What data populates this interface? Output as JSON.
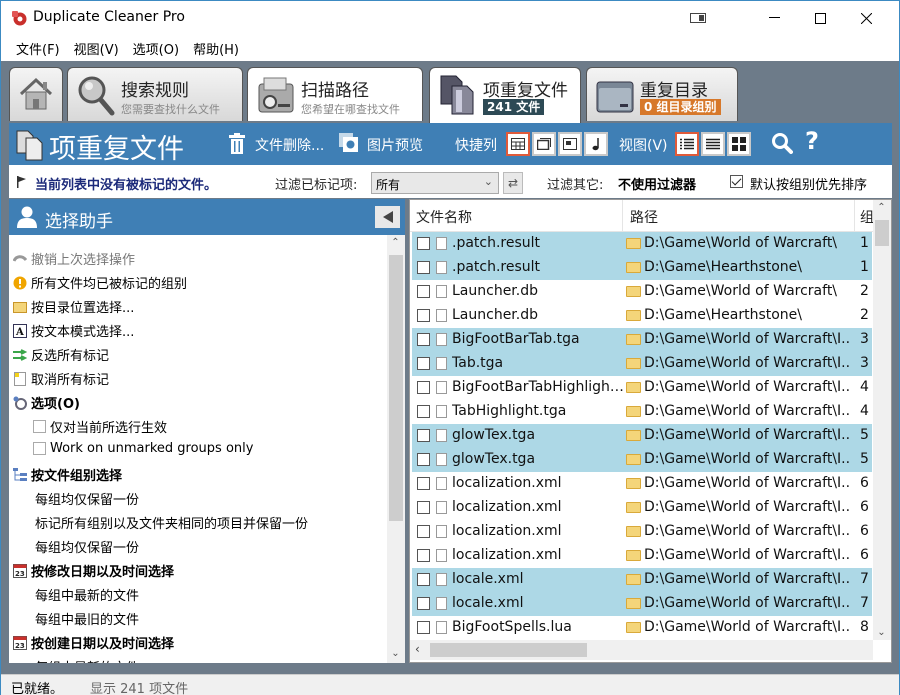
{
  "window": {
    "title": "Duplicate Cleaner Pro",
    "controls": {
      "extra": "▭",
      "minimize": "—",
      "maximize": "☐",
      "close": "✕"
    }
  },
  "menu": [
    "文件(F)",
    "视图(V)",
    "选项(O)",
    "帮助(H)"
  ],
  "tabs": [
    {
      "id": "home",
      "title": "",
      "sub": ""
    },
    {
      "id": "search-rules",
      "title": "搜索规则",
      "sub": "您需要查找什么文件"
    },
    {
      "id": "scan-path",
      "title": "扫描路径",
      "sub": "您希望在哪查找文件"
    },
    {
      "id": "duplicate-files",
      "title": "项重复文件",
      "badge": "241 文件",
      "badge_color": "#2d4a55"
    },
    {
      "id": "duplicate-folders",
      "title": "重复目录",
      "badge": "0 组目录组别",
      "badge_color": "#d7782a"
    }
  ],
  "toolbar": {
    "title": "项重复文件",
    "delete_label": "文件删除...",
    "preview_label": "图片预览",
    "quick_columns_label": "快捷列",
    "view_label": "视图(V)",
    "search_icon": "search-icon",
    "help_label": "?"
  },
  "filterbar": {
    "status_message": "当前列表中没有被标记的文件。",
    "filter_marked_label": "过滤已标记项:",
    "filter_marked_value": "所有",
    "filter_other_label": "过滤其它:",
    "filter_other_value": "不使用过滤器",
    "sort_by_group_label": "默认按组别优先排序",
    "sort_by_group_checked": true
  },
  "selection_assistant": {
    "title": "选择助手",
    "items": [
      {
        "label": "撤销上次选择操作",
        "icon": "undo-icon",
        "style": "gray"
      },
      {
        "label": "所有文件均已被标记的组别",
        "icon": "warning-icon",
        "style": "normal"
      },
      {
        "label": "按目录位置选择...",
        "icon": "folder-icon",
        "style": "normal"
      },
      {
        "label": "按文本模式选择...",
        "icon": "text-pattern-icon",
        "style": "normal"
      },
      {
        "label": "反选所有标记",
        "icon": "invert-icon",
        "style": "normal"
      },
      {
        "label": "取消所有标记",
        "icon": "clear-marks-icon",
        "style": "normal"
      },
      {
        "label": "选项(O)",
        "icon": "options-icon",
        "style": "bold"
      },
      {
        "label": "仅对当前所选行生效",
        "icon": "checkbox",
        "style": "option"
      },
      {
        "label": "Work on unmarked groups only",
        "icon": "checkbox",
        "style": "option"
      },
      {
        "label": "按文件组别选择",
        "icon": "group-icon",
        "style": "bold"
      },
      {
        "label": "每组均仅保留一份",
        "icon": "",
        "style": "sub"
      },
      {
        "label": "标记所有组别以及文件夹相同的项目并保留一份",
        "icon": "",
        "style": "sub"
      },
      {
        "label": "每组均仅保留一份",
        "icon": "",
        "style": "sub"
      },
      {
        "label": "按修改日期以及时间选择",
        "icon": "calendar-icon",
        "style": "bold"
      },
      {
        "label": "每组中最新的文件",
        "icon": "",
        "style": "sub"
      },
      {
        "label": "每组中最旧的文件",
        "icon": "",
        "style": "sub"
      },
      {
        "label": "按创建日期以及时间选择",
        "icon": "calendar-icon",
        "style": "bold"
      },
      {
        "label": "每组中最新的文件",
        "icon": "",
        "style": "sub"
      }
    ]
  },
  "file_list": {
    "columns": [
      "文件名称",
      "路径",
      "组"
    ],
    "rows": [
      {
        "name": ".patch.result",
        "path": "D:\\Game\\World of Warcraft\\",
        "group": "1",
        "highlight": true
      },
      {
        "name": ".patch.result",
        "path": "D:\\Game\\Hearthstone\\",
        "group": "1",
        "highlight": true
      },
      {
        "name": "Launcher.db",
        "path": "D:\\Game\\World of Warcraft\\",
        "group": "2",
        "highlight": false
      },
      {
        "name": "Launcher.db",
        "path": "D:\\Game\\Hearthstone\\",
        "group": "2",
        "highlight": false
      },
      {
        "name": "BigFootBarTab.tga",
        "path": "D:\\Game\\World of Warcraft\\I...",
        "group": "3",
        "highlight": true
      },
      {
        "name": "Tab.tga",
        "path": "D:\\Game\\World of Warcraft\\I...",
        "group": "3",
        "highlight": true
      },
      {
        "name": "BigFootBarTabHighlight...",
        "path": "D:\\Game\\World of Warcraft\\I...",
        "group": "4",
        "highlight": false
      },
      {
        "name": "TabHighlight.tga",
        "path": "D:\\Game\\World of Warcraft\\I...",
        "group": "4",
        "highlight": false
      },
      {
        "name": "glowTex.tga",
        "path": "D:\\Game\\World of Warcraft\\I...",
        "group": "5",
        "highlight": true
      },
      {
        "name": "glowTex.tga",
        "path": "D:\\Game\\World of Warcraft\\I...",
        "group": "5",
        "highlight": true
      },
      {
        "name": "localization.xml",
        "path": "D:\\Game\\World of Warcraft\\I...",
        "group": "6",
        "highlight": false
      },
      {
        "name": "localization.xml",
        "path": "D:\\Game\\World of Warcraft\\I...",
        "group": "6",
        "highlight": false
      },
      {
        "name": "localization.xml",
        "path": "D:\\Game\\World of Warcraft\\I...",
        "group": "6",
        "highlight": false
      },
      {
        "name": "localization.xml",
        "path": "D:\\Game\\World of Warcraft\\I...",
        "group": "6",
        "highlight": false
      },
      {
        "name": "locale.xml",
        "path": "D:\\Game\\World of Warcraft\\I...",
        "group": "7",
        "highlight": true
      },
      {
        "name": "locale.xml",
        "path": "D:\\Game\\World of Warcraft\\I...",
        "group": "7",
        "highlight": true
      },
      {
        "name": "BigFootSpells.lua",
        "path": "D:\\Game\\World of Warcraft\\I...",
        "group": "8",
        "highlight": false
      }
    ]
  },
  "statusbar": {
    "ready": "已就绪。",
    "count": "显示 241 项文件"
  },
  "colors": {
    "accent_blue": "#3f7fb5",
    "row_highlight": "#add8e6",
    "selected_button_border": "#e05a3a",
    "badge_dark": "#2d4a55",
    "badge_orange": "#d7782a"
  }
}
